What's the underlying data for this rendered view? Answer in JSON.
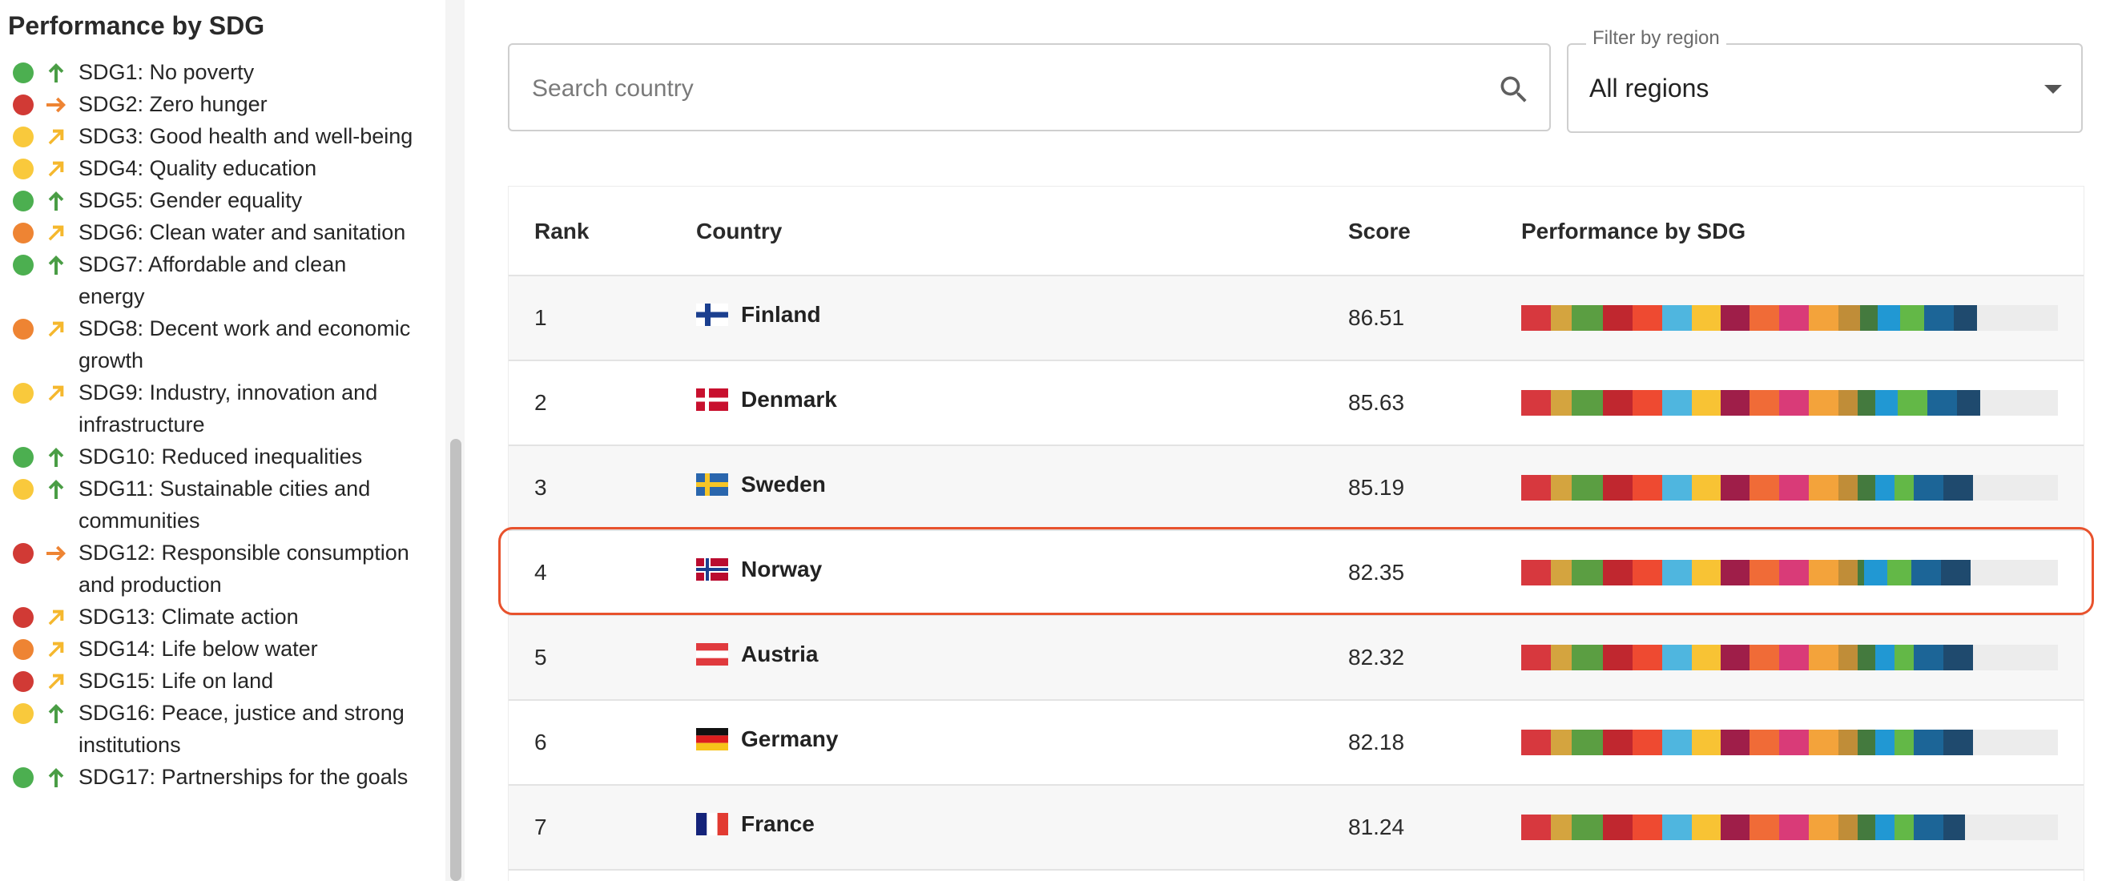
{
  "sidebar": {
    "title": "Performance by SDG",
    "items": [
      {
        "label": "SDG1: No poverty",
        "status": "green",
        "trend": "up"
      },
      {
        "label": "SDG2: Zero hunger",
        "status": "red",
        "trend": "flat"
      },
      {
        "label": "SDG3: Good health and well-being",
        "status": "yellow",
        "trend": "moderate"
      },
      {
        "label": "SDG4: Quality education",
        "status": "yellow",
        "trend": "moderate"
      },
      {
        "label": "SDG5: Gender equality",
        "status": "green",
        "trend": "up"
      },
      {
        "label": "SDG6: Clean water and sanitation",
        "status": "orange",
        "trend": "moderate"
      },
      {
        "label": "SDG7: Affordable and clean energy",
        "status": "green",
        "trend": "up"
      },
      {
        "label": "SDG8: Decent work and economic growth",
        "status": "orange",
        "trend": "moderate"
      },
      {
        "label": "SDG9: Industry, innovation and infrastructure",
        "status": "yellow",
        "trend": "moderate"
      },
      {
        "label": "SDG10: Reduced inequalities",
        "status": "green",
        "trend": "up"
      },
      {
        "label": "SDG11: Sustainable cities and communities",
        "status": "yellow",
        "trend": "up"
      },
      {
        "label": "SDG12: Responsible consumption and production",
        "status": "red",
        "trend": "flat"
      },
      {
        "label": "SDG13: Climate action",
        "status": "red",
        "trend": "moderate"
      },
      {
        "label": "SDG14: Life below water",
        "status": "orange",
        "trend": "moderate"
      },
      {
        "label": "SDG15: Life on land",
        "status": "red",
        "trend": "moderate"
      },
      {
        "label": "SDG16: Peace, justice and strong institutions",
        "status": "yellow",
        "trend": "up"
      },
      {
        "label": "SDG17: Partnerships for the goals",
        "status": "green",
        "trend": "up"
      }
    ]
  },
  "colors": {
    "status": {
      "green": "#4caf50",
      "red": "#d13a35",
      "yellow": "#f9c93c",
      "orange": "#ee8433"
    },
    "trend": {
      "up": "#4a9d45",
      "flat": "#ee8433",
      "moderate": "#f5b82e"
    },
    "highlight": "#e8522d",
    "sdg": [
      "#d7383e",
      "#d4a43f",
      "#5b9e42",
      "#c0272f",
      "#ee4a31",
      "#4fb6df",
      "#f8c334",
      "#9f1e49",
      "#f06b37",
      "#d93b78",
      "#f3a33b",
      "#c08d38",
      "#447a3e",
      "#2198d3",
      "#63b847",
      "#1c6597",
      "#1f4a6e"
    ]
  },
  "search": {
    "placeholder": "Search country"
  },
  "filter": {
    "legend": "Filter by region",
    "value": "All regions"
  },
  "table": {
    "headers": {
      "rank": "Rank",
      "country": "Country",
      "score": "Score",
      "performance": "Performance by SDG"
    },
    "rows": [
      {
        "rank": "1",
        "country": "Finland",
        "score": "86.51",
        "highlighted": false
      },
      {
        "rank": "2",
        "country": "Denmark",
        "score": "85.63",
        "highlighted": false
      },
      {
        "rank": "3",
        "country": "Sweden",
        "score": "85.19",
        "highlighted": false
      },
      {
        "rank": "4",
        "country": "Norway",
        "score": "82.35",
        "highlighted": true
      },
      {
        "rank": "5",
        "country": "Austria",
        "score": "82.32",
        "highlighted": false
      },
      {
        "rank": "6",
        "country": "Germany",
        "score": "82.18",
        "highlighted": false
      },
      {
        "rank": "7",
        "country": "France",
        "score": "81.24",
        "highlighted": false
      }
    ]
  }
}
